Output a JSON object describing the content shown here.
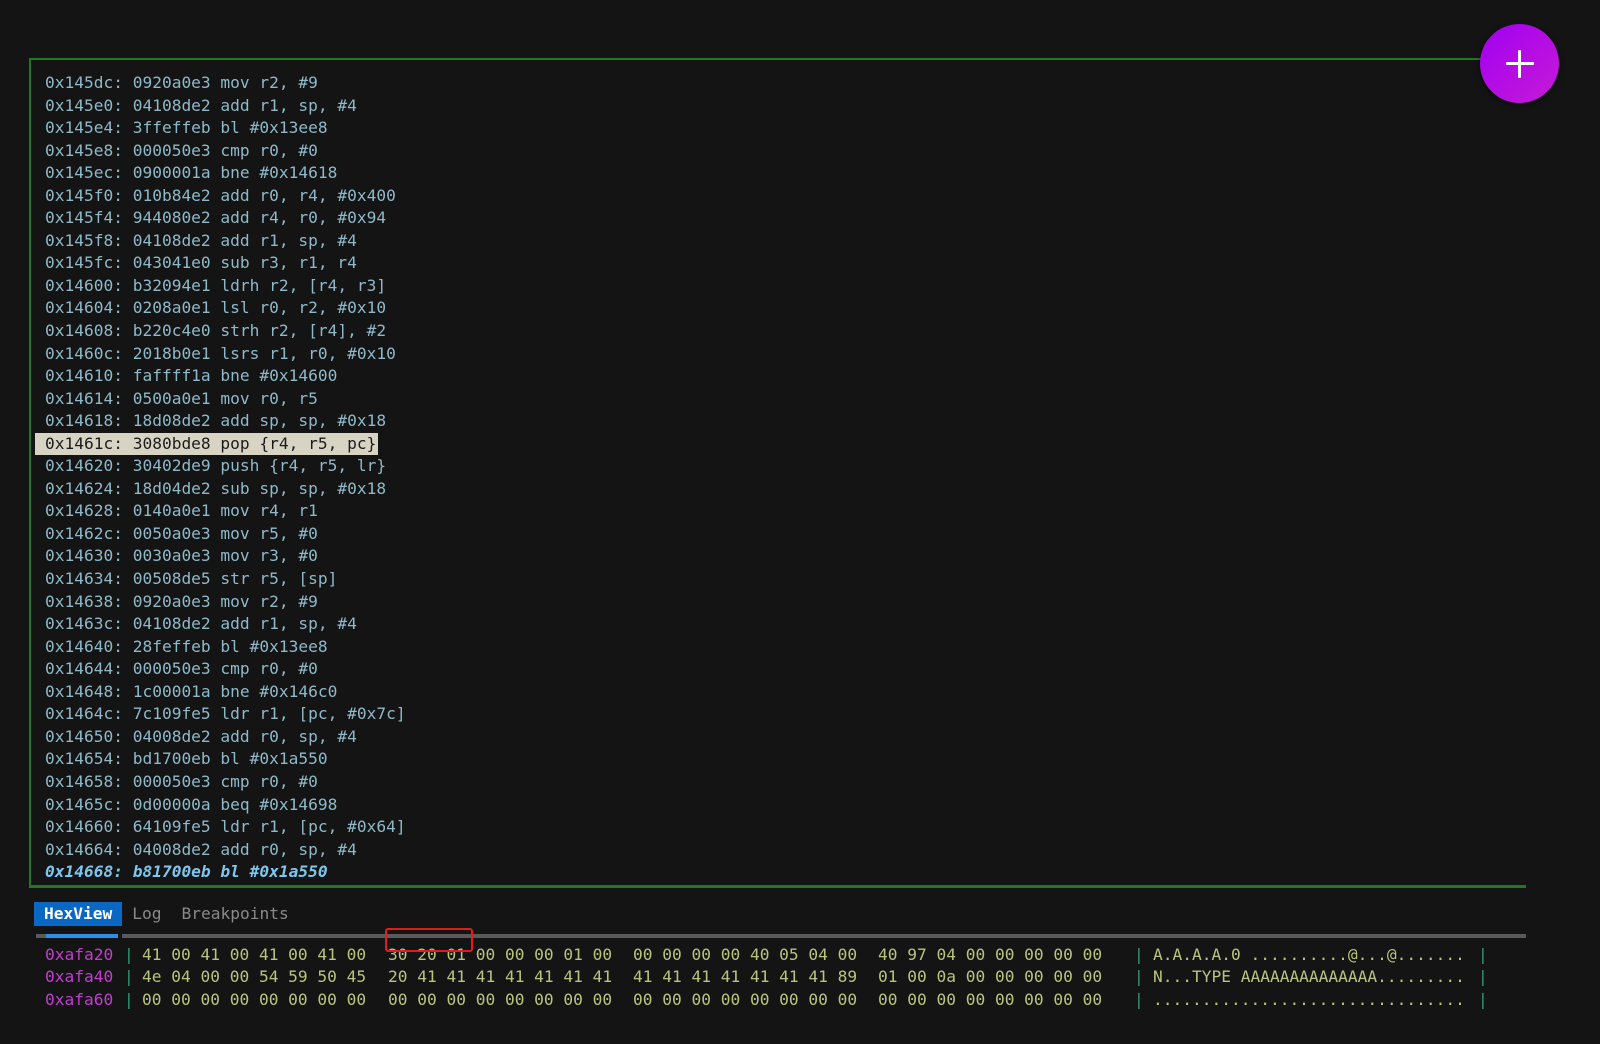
{
  "disassembly": {
    "lines": [
      "0x145dc: 0920a0e3 mov r2, #9",
      "0x145e0: 04108de2 add r1, sp, #4",
      "0x145e4: 3ffeffeb bl #0x13ee8",
      "0x145e8: 000050e3 cmp r0, #0",
      "0x145ec: 0900001a bne #0x14618",
      "0x145f0: 010b84e2 add r0, r4, #0x400",
      "0x145f4: 944080e2 add r4, r0, #0x94",
      "0x145f8: 04108de2 add r1, sp, #4",
      "0x145fc: 043041e0 sub r3, r1, r4",
      "0x14600: b32094e1 ldrh r2, [r4, r3]",
      "0x14604: 0208a0e1 lsl r0, r2, #0x10",
      "0x14608: b220c4e0 strh r2, [r4], #2",
      "0x1460c: 2018b0e1 lsrs r1, r0, #0x10",
      "0x14610: faffff1a bne #0x14600",
      "0x14614: 0500a0e1 mov r0, r5",
      "0x14618: 18d08de2 add sp, sp, #0x18",
      "0x1461c: 3080bde8 pop {r4, r5, pc}",
      "0x14620: 30402de9 push {r4, r5, lr}",
      "0x14624: 18d04de2 sub sp, sp, #0x18",
      "0x14628: 0140a0e1 mov r4, r1",
      "0x1462c: 0050a0e3 mov r5, #0",
      "0x14630: 0030a0e3 mov r3, #0",
      "0x14634: 00508de5 str r5, [sp]",
      "0x14638: 0920a0e3 mov r2, #9",
      "0x1463c: 04108de2 add r1, sp, #4",
      "0x14640: 28feffeb bl #0x13ee8",
      "0x14644: 000050e3 cmp r0, #0",
      "0x14648: 1c00001a bne #0x146c0",
      "0x1464c: 7c109fe5 ldr r1, [pc, #0x7c]",
      "0x14650: 04008de2 add r0, sp, #4",
      "0x14654: bd1700eb bl #0x1a550",
      "0x14658: 000050e3 cmp r0, #0",
      "0x1465c: 0d00000a beq #0x14698",
      "0x14660: 64109fe5 ldr r1, [pc, #0x64]",
      "0x14664: 04008de2 add r0, sp, #4",
      "0x14668: b81700eb bl #0x1a550"
    ],
    "selected_index": 16,
    "current_index": 35
  },
  "fab": {
    "icon": "plus-icon",
    "color": "#b00ee6"
  },
  "tabs": [
    {
      "label": "HexView",
      "active": true
    },
    {
      "label": "Log",
      "active": false
    },
    {
      "label": "Breakpoints",
      "active": false
    }
  ],
  "hexview": {
    "rows": [
      {
        "address": "0xafa20",
        "groups": [
          "41 00 41 00 41 00 41 00",
          "30 20 01 00 00 00 01 00",
          "00 00 00 00 40 05 04 00",
          "40 97 04 00 00 00 00 00"
        ],
        "ascii": "A.A.A.A.0 ..........@...@......."
      },
      {
        "address": "0xafa40",
        "groups": [
          "4e 04 00 00 54 59 50 45",
          "20 41 41 41 41 41 41 41",
          "41 41 41 41 41 41 41 89",
          "01 00 0a 00 00 00 00 00"
        ],
        "ascii": "N...TYPE AAAAAAAAAAAAAA........."
      },
      {
        "address": "0xafa60",
        "groups": [
          "00 00 00 00 00 00 00 00",
          "00 00 00 00 00 00 00 00",
          "00 00 00 00 00 00 00 00",
          "00 00 00 00 00 00 00 00"
        ],
        "ascii": "................................"
      }
    ],
    "separator": "|",
    "highlight": {
      "row": 0,
      "bytes": "30 20 01",
      "color": "#e21b1b"
    }
  }
}
